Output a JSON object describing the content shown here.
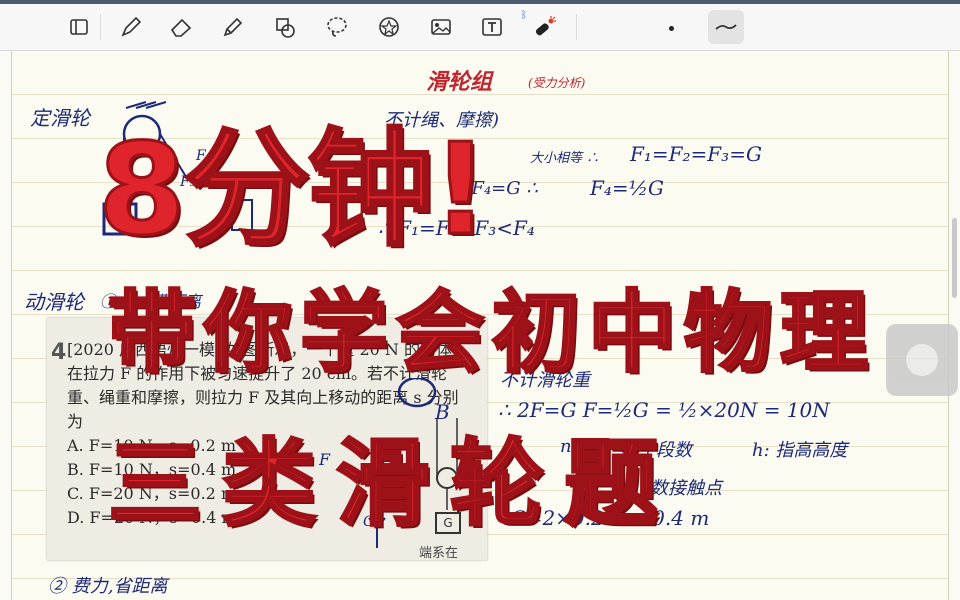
{
  "toolbar": {
    "tools": [
      "sidebar-icon",
      "pen-icon",
      "eraser-icon",
      "highlighter-icon",
      "shapes-icon",
      "lasso-icon",
      "sticker-icon",
      "image-icon",
      "text-icon",
      "laser-pointer-icon"
    ],
    "bluetooth": "ᛒ"
  },
  "notes": {
    "title": "滑轮组",
    "title_note": "(受力分析)",
    "fixed_pulley": "定滑轮",
    "ignore_friction": "不计绳、摩擦)",
    "line1": "F₁=F₂=F₃=G",
    "line1_prefix": "大小相等 ∴",
    "line2": "F₄=½G",
    "line2_prefix": "2F₄=G ∴",
    "line3": "∴ F₁=F₂=F₃<F₄",
    "moving_pulley": "动滑轮",
    "moving_note": "① 省力费距离",
    "ignore_pulley_weight": "不计滑轮重",
    "eq1": "∴ 2F=G   F=½G = ½×20N = 10N",
    "eq2_n": "n",
    "eq2_desc": "绳子段数",
    "eq2_h": "h: 指高高度",
    "eq3": "数接触点",
    "eq4": "S=2×0.2m = 0.4 m",
    "bottom_note": "② 费力,省距离",
    "circle_letter": "B",
    "label_F": "F",
    "label_G": "G",
    "weight_box": "G",
    "pulley_F1": "F₁",
    "pulley_F3": "F₃",
    "pulley_F4": "F₄",
    "pulley_G": "G"
  },
  "problem": {
    "number": "4",
    "lines": [
      "[2020 广西梧州一模] 如图所示，一个重 20 N 的物体",
      "在拉力 F 的作用下被匀速提升了 20 cm。若不计滑轮",
      "重、绳重和摩擦，则拉力 F 及其向上移动的距离 s 分别",
      "为"
    ],
    "options": [
      "A. F=10 N，s=0.2 m",
      "B. F=10 N，s=0.4 m",
      "C. F=20 N，s=0.2 m",
      "D. F=20 N，s=0.4 m"
    ],
    "footer": "端系在"
  },
  "overlay": {
    "line1": "8分钟!",
    "line2": "带你学会初中物理",
    "line3": "三类滑轮题"
  }
}
